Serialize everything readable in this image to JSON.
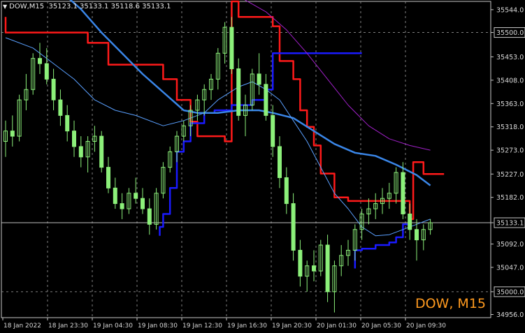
{
  "header": {
    "symbol": "DOW,M15",
    "ohlc": "35123.1 35133.1 35118.6 35133.1"
  },
  "watermark": "DOW, M15",
  "colors": {
    "background": "#000000",
    "candles": "#8cf07a",
    "price_line": "#c0c0c0",
    "red_line": "#ff1a1a",
    "blue_line": "#1a1aff",
    "ma_slow": "#3a86e8",
    "ma_fast": "#5aa0ff",
    "purple_line": "#a020c8",
    "axis_text": "#d8d8d8",
    "grid": "#808080",
    "watermark": "#ff9a1f"
  },
  "chart_data": {
    "type": "candlestick",
    "title": "DOW,M15",
    "y_ticks": [
      35544.0,
      35500.0,
      35453.0,
      35408.0,
      35363.0,
      35318.0,
      35273.0,
      35227.0,
      35182.0,
      35133.1,
      35092.0,
      35047.0,
      35000.0,
      34956.0
    ],
    "y_highlighted": [
      "35500.0",
      "35133.1",
      "35000.0"
    ],
    "ylim": [
      34950,
      35560
    ],
    "x_ticks": [
      "18 Jan 2022",
      "18 Jan 23:30",
      "19 Jan 04:30",
      "19 Jan 08:30",
      "19 Jan 12:30",
      "19 Jan 16:30",
      "19 Jan 20:30",
      "20 Jan 01:30",
      "20 Jan 05:30",
      "20 Jan 09:30"
    ],
    "grid": "dashed at 35500.0, 35000.0 and time ticks",
    "current_price": 35133.1,
    "series": [
      {
        "name": "",
        "color": "red",
        "values": [
          [
            0,
            35530
          ],
          [
            0,
            35500
          ],
          [
            12,
            35500
          ],
          [
            12,
            35480
          ],
          [
            15,
            35480
          ],
          [
            15,
            35438
          ],
          [
            23,
            35438
          ],
          [
            23,
            35410
          ],
          [
            25,
            35410
          ],
          [
            25,
            35370
          ],
          [
            27,
            35370
          ],
          [
            27,
            35328
          ],
          [
            28,
            35328
          ],
          [
            28,
            35300
          ],
          [
            32,
            35300
          ],
          [
            32,
            35290
          ],
          [
            33,
            35290
          ],
          [
            33,
            35560
          ],
          [
            34,
            35560
          ],
          [
            34,
            35530
          ],
          [
            39,
            35530
          ],
          [
            39,
            35512
          ],
          [
            40,
            35512
          ],
          [
            40,
            35445
          ],
          [
            42,
            35445
          ],
          [
            42,
            35410
          ],
          [
            43,
            35410
          ],
          [
            43,
            35350
          ],
          [
            44,
            35350
          ],
          [
            44,
            35318
          ],
          [
            45,
            35318
          ],
          [
            45,
            35282
          ],
          [
            46,
            35282
          ],
          [
            46,
            35228
          ],
          [
            48,
            35228
          ],
          [
            48,
            35182
          ],
          [
            50,
            35182
          ],
          [
            50,
            35175
          ],
          [
            59,
            35175
          ],
          [
            59,
            35140
          ],
          [
            59.5,
            35140
          ],
          [
            59.5,
            35250
          ],
          [
            61,
            35250
          ],
          [
            61,
            35227
          ],
          [
            64,
            35227
          ]
        ]
      },
      {
        "name": "",
        "color": "blue",
        "values": [
          [
            22.5,
            35108
          ],
          [
            22.5,
            35125
          ],
          [
            23,
            35125
          ],
          [
            23,
            35150
          ],
          [
            24,
            35150
          ],
          [
            24,
            35200
          ],
          [
            25,
            35200
          ],
          [
            25,
            35270
          ],
          [
            26,
            35270
          ],
          [
            26,
            35290
          ],
          [
            27,
            35290
          ],
          [
            27,
            35325
          ],
          [
            29,
            35325
          ],
          [
            29,
            35345
          ],
          [
            30.5,
            35345
          ],
          [
            30.5,
            35350
          ],
          [
            33,
            35350
          ],
          [
            33,
            35360
          ],
          [
            36,
            35360
          ],
          [
            36,
            35370
          ],
          [
            38,
            35370
          ],
          [
            38,
            35390
          ],
          [
            39,
            35390
          ],
          [
            39,
            35460
          ],
          [
            40,
            35460
          ],
          [
            52,
            35460
          ]
        ]
      },
      {
        "name": "",
        "color": "blue",
        "values": [
          [
            51,
            35045
          ],
          [
            51,
            35080
          ],
          [
            52,
            35080
          ],
          [
            52,
            35083
          ],
          [
            54,
            35083
          ],
          [
            54,
            35090
          ],
          [
            56,
            35090
          ],
          [
            56,
            35095
          ],
          [
            57,
            35095
          ],
          [
            57,
            35105
          ],
          [
            58,
            35105
          ],
          [
            58,
            35130
          ],
          [
            59,
            35130
          ],
          [
            59,
            35140
          ]
        ]
      },
      {
        "name": "",
        "color": "ma_slow",
        "values": [
          [
            0,
            35600
          ],
          [
            8,
            35580
          ],
          [
            11,
            35545
          ],
          [
            14,
            35500
          ],
          [
            17,
            35460
          ],
          [
            20,
            35420
          ],
          [
            23,
            35385
          ],
          [
            26,
            35350
          ],
          [
            28,
            35345
          ],
          [
            31,
            35345
          ],
          [
            34,
            35350
          ],
          [
            37,
            35350
          ],
          [
            39,
            35345
          ],
          [
            42,
            35335
          ],
          [
            45,
            35310
          ],
          [
            48,
            35285
          ],
          [
            51,
            35268
          ],
          [
            54,
            35262
          ],
          [
            57,
            35245
          ],
          [
            60,
            35225
          ],
          [
            62,
            35205
          ]
        ]
      },
      {
        "name": "",
        "color": "ma_fast",
        "values": [
          [
            0,
            35490
          ],
          [
            4,
            35470
          ],
          [
            7,
            35440
          ],
          [
            10,
            35410
          ],
          [
            13,
            35370
          ],
          [
            16,
            35350
          ],
          [
            19,
            35340
          ],
          [
            23,
            35320
          ],
          [
            26,
            35330
          ],
          [
            29,
            35345
          ],
          [
            31,
            35370
          ],
          [
            34,
            35395
          ],
          [
            36,
            35405
          ],
          [
            38,
            35390
          ],
          [
            40,
            35370
          ],
          [
            42,
            35330
          ],
          [
            44,
            35290
          ],
          [
            46,
            35240
          ],
          [
            48,
            35190
          ],
          [
            50,
            35160
          ],
          [
            52,
            35125
          ],
          [
            54,
            35108
          ],
          [
            56,
            35110
          ],
          [
            58,
            35120
          ],
          [
            60,
            35130
          ],
          [
            62,
            35140
          ]
        ]
      },
      {
        "name": "",
        "color": "purple",
        "values": [
          [
            28,
            35600
          ],
          [
            34,
            35570
          ],
          [
            38,
            35540
          ],
          [
            41,
            35505
          ],
          [
            44,
            35460
          ],
          [
            47,
            35410
          ],
          [
            50,
            35360
          ],
          [
            53,
            35320
          ],
          [
            56,
            35295
          ],
          [
            59,
            35282
          ],
          [
            62,
            35273
          ]
        ]
      }
    ],
    "candles": [
      [
        35290,
        35330,
        35260,
        35310
      ],
      [
        35310,
        35340,
        35280,
        35300
      ],
      [
        35300,
        35380,
        35290,
        35370
      ],
      [
        35370,
        35420,
        35350,
        35390
      ],
      [
        35390,
        35460,
        35380,
        35450
      ],
      [
        35450,
        35480,
        35420,
        35440
      ],
      [
        35440,
        35470,
        35400,
        35410
      ],
      [
        35410,
        35430,
        35350,
        35370
      ],
      [
        35370,
        35390,
        35320,
        35340
      ],
      [
        35340,
        35360,
        35290,
        35310
      ],
      [
        35310,
        35330,
        35260,
        35280
      ],
      [
        35280,
        35300,
        35240,
        35260
      ],
      [
        35260,
        35300,
        35230,
        35290
      ],
      [
        35290,
        35320,
        35270,
        35300
      ],
      [
        35300,
        35310,
        35230,
        35240
      ],
      [
        35240,
        35260,
        35190,
        35200
      ],
      [
        35200,
        35220,
        35160,
        35170
      ],
      [
        35170,
        35190,
        35140,
        35160
      ],
      [
        35160,
        35200,
        35150,
        35190
      ],
      [
        35190,
        35220,
        35170,
        35180
      ],
      [
        35180,
        35200,
        35150,
        35160
      ],
      [
        35160,
        35180,
        35110,
        35130
      ],
      [
        35130,
        35200,
        35120,
        35190
      ],
      [
        35190,
        35250,
        35180,
        35240
      ],
      [
        35240,
        35280,
        35230,
        35270
      ],
      [
        35270,
        35310,
        35250,
        35300
      ],
      [
        35300,
        35330,
        35290,
        35320
      ],
      [
        35320,
        35360,
        35300,
        35350
      ],
      [
        35350,
        35380,
        35330,
        35370
      ],
      [
        35370,
        35400,
        35340,
        35390
      ],
      [
        35390,
        35420,
        35370,
        35410
      ],
      [
        35410,
        35470,
        35390,
        35460
      ],
      [
        35460,
        35520,
        35440,
        35510
      ],
      [
        35510,
        35530,
        35420,
        35430
      ],
      [
        35430,
        35450,
        35330,
        35340
      ],
      [
        35340,
        35380,
        35300,
        35360
      ],
      [
        35360,
        35430,
        35350,
        35420
      ],
      [
        35420,
        35460,
        35380,
        35400
      ],
      [
        35400,
        35420,
        35330,
        35340
      ],
      [
        35340,
        35360,
        35260,
        35280
      ],
      [
        35280,
        35300,
        35200,
        35220
      ],
      [
        35220,
        35240,
        35150,
        35170
      ],
      [
        35170,
        35190,
        35060,
        35080
      ],
      [
        35080,
        35100,
        35010,
        35030
      ],
      [
        35030,
        35060,
        35000,
        35050
      ],
      [
        35050,
        35080,
        35020,
        35040
      ],
      [
        35040,
        35100,
        35030,
        35090
      ],
      [
        35090,
        35110,
        34980,
        35000
      ],
      [
        35000,
        35060,
        34960,
        35050
      ],
      [
        35050,
        35090,
        35030,
        35070
      ],
      [
        35070,
        35100,
        35050,
        35080
      ],
      [
        35080,
        35130,
        35060,
        35120
      ],
      [
        35120,
        35160,
        35100,
        35150
      ],
      [
        35150,
        35180,
        35130,
        35160
      ],
      [
        35160,
        35190,
        35140,
        35170
      ],
      [
        35170,
        35200,
        35150,
        35180
      ],
      [
        35180,
        35210,
        35160,
        35190
      ],
      [
        35190,
        35240,
        35170,
        35230
      ],
      [
        35230,
        35250,
        35140,
        35150
      ],
      [
        35150,
        35170,
        35100,
        35120
      ],
      [
        35120,
        35140,
        35060,
        35100
      ],
      [
        35100,
        35130,
        35080,
        35120
      ],
      [
        35120,
        35140,
        35110,
        35133.1
      ]
    ]
  }
}
